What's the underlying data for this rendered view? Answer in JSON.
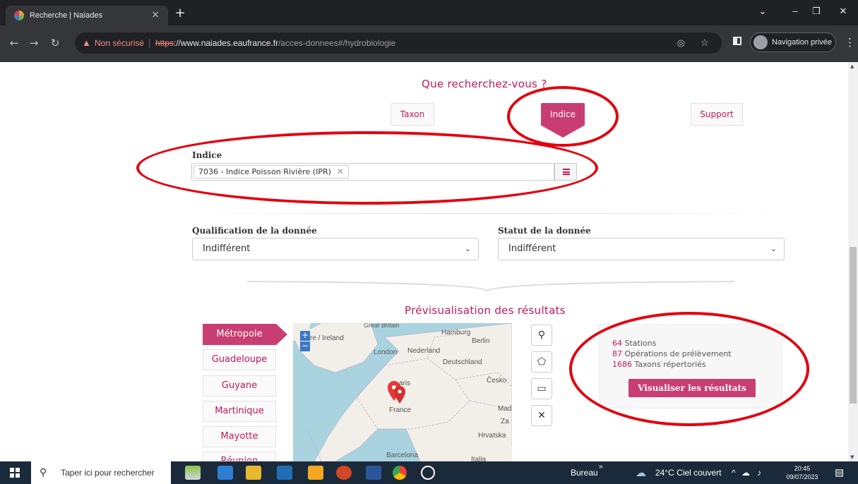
{
  "browser": {
    "tab_title": "Recherche | Naïades",
    "tab_close": "×",
    "new_tab": "+",
    "security_label": "Non sécurisé",
    "url_scheme": "https",
    "url_host": "://www.naiades.eaufrance.fr",
    "url_path": "/acces-donnees#/hydrobiologie",
    "incognito_label": "Navigation privée"
  },
  "page": {
    "question_title": "Que recherchez-vous ?",
    "search_types": [
      "Taxon",
      "Indice",
      "Support"
    ],
    "active_search_type": "Indice",
    "indice_label": "Indice",
    "indice_tag": "7036 - Indice Poisson Rivière (IPR)",
    "qualification_label": "Qualification de la donnée",
    "qualification_value": "Indifférent",
    "statut_label": "Statut de la donnée",
    "statut_value": "Indifférent",
    "preview_title": "Prévisualisation des résultats",
    "regions": [
      "Métropole",
      "Guadeloupe",
      "Guyane",
      "Martinique",
      "Mayotte",
      "Réunion"
    ],
    "active_region": "Métropole",
    "map_labels": {
      "great_britain": "Great Britain",
      "ireland": "re / Ireland",
      "hamburg": "Hamburg",
      "berlin": "Berlin",
      "london": "London",
      "nederland": "Nederland",
      "deutschland": "Deutschland",
      "cesko": "Česko",
      "paris": "aris",
      "france": "France",
      "mad": "Mad",
      "za": "Za",
      "hrvatska": "Hrvatska",
      "barcelona": "Barcelona",
      "italia": "Italia"
    },
    "results": {
      "stations_count": "64",
      "stations_label": "Stations",
      "operations_count": "87",
      "operations_label": "Opérations de prélèvement",
      "taxons_count": "1686",
      "taxons_label": "Taxons répertoriés",
      "button_label": "Visualiser les résultats"
    }
  },
  "taskbar": {
    "search_placeholder": "Taper ici pour rechercher",
    "desktop_label": "Bureau",
    "weather": "24°C  Ciel couvert",
    "time": "20:45",
    "date": "09/07/2023"
  },
  "colors": {
    "accent": "#c93e72",
    "annotation": "#e3000f"
  }
}
